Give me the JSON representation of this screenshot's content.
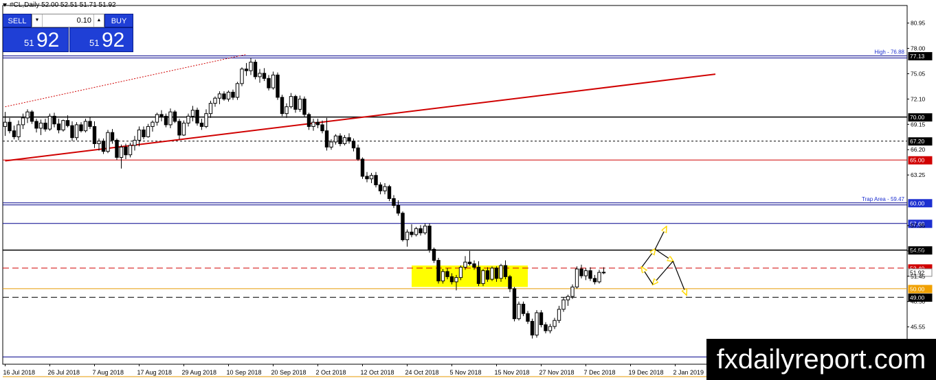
{
  "header": {
    "symbol_line": "#CL,Daily  52.00 52.51 51.71 51.92"
  },
  "trade_panel": {
    "sell_label": "SELL",
    "buy_label": "BUY",
    "lot_value": "0.10",
    "sell_price_small": "51",
    "sell_price_big": "92",
    "buy_price_small": "51",
    "buy_price_big": "92"
  },
  "watermark": "fxdailyreport.com",
  "chart_data": {
    "type": "candlestick",
    "title": "#CL,Daily",
    "ylim": [
      41.2,
      83.0
    ],
    "y_ticks": [
      "80.95",
      "78.00",
      "75.05",
      "72.10",
      "69.15",
      "66.20",
      "63.25",
      "57.35",
      "54.40",
      "51.45",
      "48.50",
      "45.55",
      "42.60"
    ],
    "x_labels": [
      "16 Jul 2018",
      "26 Jul 2018",
      "7 Aug 2018",
      "17 Aug 2018",
      "29 Aug 2018",
      "10 Sep 2018",
      "20 Sep 2018",
      "2 Oct 2018",
      "12 Oct 2018",
      "24 Oct 2018",
      "5 Nov 2018",
      "15 Nov 2018",
      "27 Nov 2018",
      "7 Dec 2018",
      "19 Dec 2018",
      "2 Jan 2019"
    ],
    "levels": [
      {
        "value": 77.13,
        "label": "77.13",
        "color": "#00008b",
        "style": "solid",
        "tag_color": "#000000",
        "note": "High - 76.88"
      },
      {
        "value": 70.0,
        "label": "70.00",
        "color": "#000000",
        "style": "solid",
        "tag_color": "#000000"
      },
      {
        "value": 67.2,
        "label": "67.20",
        "color": "#000000",
        "style": "dotted",
        "tag_color": "#000000"
      },
      {
        "value": 65.0,
        "label": "65.00",
        "color": "#d00000",
        "style": "solid",
        "tag_color": "#d00000"
      },
      {
        "value": 60.0,
        "label": "60.00",
        "color": "#00008b",
        "style": "solid",
        "tag_color": "#1c2fd0",
        "note": "Trap Area - 59.47"
      },
      {
        "value": 57.6,
        "label": "57.60",
        "color": "#00008b",
        "style": "solid",
        "tag_color": "#1c2fd0"
      },
      {
        "value": 54.5,
        "label": "54.50",
        "color": "#000000",
        "style": "solid",
        "tag_color": "#000000"
      },
      {
        "value": 52.4,
        "label": "52.40",
        "color": "#d00000",
        "style": "dashed",
        "tag_color": "#d00000"
      },
      {
        "value": 51.92,
        "label": "51.92",
        "color": "#9a9a9a",
        "style": "none",
        "tag_color": "#ffffff"
      },
      {
        "value": 50.0,
        "label": "50.00",
        "color": "#e69a00",
        "style": "solid",
        "tag_color": "#f0a000"
      },
      {
        "value": 49.0,
        "label": "49.00",
        "color": "#000000",
        "style": "dashed",
        "tag_color": "#000000"
      },
      {
        "value": 42.05,
        "label": "",
        "color": "#00008b",
        "style": "solid",
        "tag_color": "",
        "note": "Low - 42.05"
      },
      {
        "value": 39.75,
        "label": "",
        "color": "#e69a00",
        "style": "solid",
        "tag_color": "#e69a00"
      }
    ],
    "trendlines": [
      {
        "name": "red-trendline",
        "color": "#d00000",
        "from": [
          0,
          64.9
        ],
        "to": [
          159,
          75.0
        ],
        "style": "solid"
      },
      {
        "name": "red-dotted-trendline",
        "color": "#d00000",
        "from": [
          0,
          71.2
        ],
        "to": [
          54,
          77.3
        ],
        "style": "dotted"
      }
    ],
    "zone": {
      "color": "#ffff00",
      "from_x": 91,
      "to_x": 117,
      "y_low": 50.2,
      "y_high": 52.7
    },
    "candles": [
      [
        68.9,
        70.6,
        67.8,
        69.4
      ],
      [
        69.4,
        69.9,
        68.1,
        68.4
      ],
      [
        68.4,
        69.0,
        67.4,
        67.7
      ],
      [
        67.7,
        69.6,
        67.3,
        69.1
      ],
      [
        69.1,
        70.4,
        68.6,
        69.9
      ],
      [
        69.9,
        70.9,
        69.3,
        70.6
      ],
      [
        70.6,
        70.8,
        69.2,
        69.5
      ],
      [
        69.5,
        69.8,
        68.2,
        68.7
      ],
      [
        68.7,
        69.7,
        67.9,
        69.3
      ],
      [
        69.3,
        69.8,
        68.3,
        68.6
      ],
      [
        68.6,
        70.4,
        68.4,
        70.1
      ],
      [
        70.1,
        70.5,
        68.8,
        69.2
      ],
      [
        69.2,
        69.8,
        68.1,
        68.5
      ],
      [
        68.5,
        69.7,
        68.3,
        69.6
      ],
      [
        69.6,
        70.2,
        68.8,
        69.0
      ],
      [
        69.0,
        69.5,
        67.2,
        67.6
      ],
      [
        67.6,
        69.4,
        67.3,
        69.1
      ],
      [
        69.1,
        69.4,
        68.2,
        68.4
      ],
      [
        68.4,
        69.8,
        68.2,
        69.5
      ],
      [
        69.5,
        70.0,
        68.6,
        68.9
      ],
      [
        68.9,
        69.5,
        66.4,
        66.9
      ],
      [
        66.9,
        67.5,
        66.1,
        67.2
      ],
      [
        67.2,
        67.5,
        65.7,
        66.0
      ],
      [
        66.0,
        68.5,
        65.8,
        68.2
      ],
      [
        68.2,
        68.6,
        66.9,
        67.3
      ],
      [
        67.3,
        67.5,
        65.0,
        65.3
      ],
      [
        65.3,
        66.8,
        64.0,
        66.5
      ],
      [
        66.5,
        66.9,
        65.1,
        65.6
      ],
      [
        65.6,
        67.0,
        65.3,
        66.7
      ],
      [
        66.7,
        67.8,
        66.1,
        67.3
      ],
      [
        67.3,
        68.9,
        66.6,
        68.5
      ],
      [
        68.5,
        68.9,
        67.4,
        67.7
      ],
      [
        67.7,
        69.2,
        67.6,
        68.9
      ],
      [
        68.9,
        69.6,
        68.3,
        69.4
      ],
      [
        69.4,
        70.5,
        69.0,
        70.3
      ],
      [
        70.3,
        70.8,
        69.5,
        70.1
      ],
      [
        70.1,
        70.4,
        68.8,
        69.1
      ],
      [
        69.1,
        71.0,
        68.7,
        70.6
      ],
      [
        70.6,
        70.8,
        69.3,
        69.5
      ],
      [
        69.5,
        69.8,
        67.4,
        67.9
      ],
      [
        67.9,
        69.6,
        67.8,
        69.3
      ],
      [
        69.3,
        70.4,
        68.9,
        70.1
      ],
      [
        70.1,
        71.3,
        69.5,
        70.8
      ],
      [
        70.8,
        71.1,
        69.0,
        69.3
      ],
      [
        69.3,
        69.8,
        68.5,
        68.9
      ],
      [
        68.9,
        70.9,
        68.7,
        70.4
      ],
      [
        70.4,
        71.9,
        69.9,
        71.6
      ],
      [
        71.6,
        72.4,
        71.2,
        72.2
      ],
      [
        72.2,
        73.0,
        71.5,
        72.7
      ],
      [
        72.7,
        73.0,
        71.9,
        72.1
      ],
      [
        72.1,
        73.1,
        71.8,
        72.9
      ],
      [
        72.9,
        73.2,
        72.0,
        72.3
      ],
      [
        72.3,
        74.1,
        72.0,
        73.9
      ],
      [
        73.9,
        75.8,
        73.6,
        75.6
      ],
      [
        75.6,
        76.3,
        74.8,
        75.4
      ],
      [
        75.4,
        76.9,
        74.9,
        76.4
      ],
      [
        76.4,
        76.7,
        74.4,
        74.7
      ],
      [
        74.7,
        75.6,
        74.0,
        75.1
      ],
      [
        75.1,
        75.7,
        74.2,
        74.5
      ],
      [
        74.5,
        74.9,
        73.1,
        73.4
      ],
      [
        73.4,
        75.3,
        73.2,
        74.9
      ],
      [
        74.9,
        75.2,
        72.0,
        72.3
      ],
      [
        72.3,
        72.6,
        70.1,
        70.4
      ],
      [
        70.4,
        71.6,
        69.9,
        71.2
      ],
      [
        71.2,
        72.8,
        71.0,
        72.4
      ],
      [
        72.4,
        72.6,
        70.5,
        70.9
      ],
      [
        70.9,
        72.5,
        70.6,
        72.1
      ],
      [
        72.1,
        72.4,
        70.0,
        70.3
      ],
      [
        70.3,
        70.5,
        68.5,
        68.9
      ],
      [
        68.9,
        69.8,
        68.4,
        69.4
      ],
      [
        69.4,
        69.8,
        68.7,
        69.1
      ],
      [
        69.1,
        69.6,
        68.1,
        68.4
      ],
      [
        68.4,
        69.9,
        66.1,
        66.5
      ],
      [
        66.5,
        67.4,
        66.2,
        67.1
      ],
      [
        67.1,
        68.0,
        66.8,
        67.8
      ],
      [
        67.8,
        68.1,
        66.6,
        66.9
      ],
      [
        66.9,
        67.9,
        66.7,
        67.6
      ],
      [
        67.6,
        68.1,
        66.9,
        67.2
      ],
      [
        67.2,
        67.5,
        66.0,
        66.4
      ],
      [
        66.4,
        66.8,
        64.9,
        65.1
      ],
      [
        65.1,
        65.3,
        62.8,
        63.1
      ],
      [
        63.1,
        63.6,
        62.4,
        62.8
      ],
      [
        62.8,
        63.5,
        62.3,
        63.2
      ],
      [
        63.2,
        63.6,
        61.8,
        62.1
      ],
      [
        62.1,
        62.4,
        61.0,
        61.4
      ],
      [
        61.4,
        62.3,
        61.0,
        61.9
      ],
      [
        61.9,
        62.1,
        60.2,
        60.5
      ],
      [
        60.5,
        60.9,
        59.4,
        59.7
      ],
      [
        59.7,
        60.3,
        58.5,
        58.8
      ],
      [
        58.8,
        59.0,
        55.5,
        55.7
      ],
      [
        55.7,
        56.9,
        54.9,
        56.6
      ],
      [
        56.6,
        57.5,
        56.0,
        56.3
      ],
      [
        56.3,
        57.2,
        56.1,
        57.0
      ],
      [
        57.0,
        57.4,
        56.2,
        56.5
      ],
      [
        56.5,
        57.6,
        56.3,
        57.3
      ],
      [
        57.3,
        57.6,
        54.2,
        54.6
      ],
      [
        54.6,
        54.8,
        53.0,
        53.3
      ],
      [
        53.3,
        53.6,
        50.6,
        50.9
      ],
      [
        50.9,
        52.3,
        50.6,
        52.0
      ],
      [
        52.0,
        52.4,
        51.1,
        51.4
      ],
      [
        51.4,
        51.8,
        50.5,
        50.8
      ],
      [
        50.8,
        51.6,
        49.8,
        51.3
      ],
      [
        51.3,
        52.7,
        51.0,
        52.5
      ],
      [
        52.5,
        53.8,
        52.2,
        53.1
      ],
      [
        53.1,
        54.4,
        52.7,
        52.9
      ],
      [
        52.9,
        53.3,
        52.2,
        52.5
      ],
      [
        52.5,
        53.2,
        50.3,
        50.6
      ],
      [
        50.6,
        52.3,
        50.3,
        52.1
      ],
      [
        52.1,
        52.5,
        50.8,
        51.1
      ],
      [
        51.1,
        52.6,
        50.9,
        52.4
      ],
      [
        52.4,
        52.6,
        50.8,
        51.2
      ],
      [
        51.2,
        52.9,
        50.8,
        52.7
      ],
      [
        52.7,
        53.3,
        51.1,
        51.4
      ],
      [
        51.4,
        51.6,
        49.6,
        50.0
      ],
      [
        50.0,
        50.2,
        46.2,
        46.5
      ],
      [
        46.5,
        48.5,
        46.3,
        48.2
      ],
      [
        48.2,
        48.5,
        46.8,
        47.1
      ],
      [
        47.1,
        47.4,
        45.9,
        46.2
      ],
      [
        46.2,
        46.5,
        44.2,
        44.6
      ],
      [
        44.6,
        47.5,
        44.3,
        47.2
      ],
      [
        47.2,
        47.5,
        45.5,
        45.8
      ],
      [
        45.8,
        46.1,
        44.8,
        45.1
      ],
      [
        45.1,
        45.9,
        44.8,
        45.6
      ],
      [
        45.6,
        46.6,
        45.3,
        46.3
      ],
      [
        46.3,
        48.0,
        46.0,
        47.6
      ],
      [
        47.6,
        49.0,
        47.3,
        48.7
      ],
      [
        48.7,
        49.3,
        48.0,
        49.1
      ],
      [
        49.1,
        50.5,
        48.8,
        50.2
      ],
      [
        50.2,
        52.6,
        50.0,
        52.3
      ],
      [
        52.3,
        52.8,
        51.2,
        51.5
      ],
      [
        51.5,
        52.4,
        51.0,
        52.1
      ],
      [
        52.1,
        52.5,
        50.9,
        51.2
      ],
      [
        51.2,
        51.6,
        50.5,
        50.8
      ],
      [
        50.8,
        52.2,
        50.6,
        51.9
      ],
      [
        51.9,
        52.5,
        51.7,
        51.92
      ]
    ],
    "arrows_color": "#ffd800",
    "projection_arrows": [
      [
        [
          142.5,
          52.5
        ],
        [
          145.5,
          54.6
        ]
      ],
      [
        [
          145.5,
          54.6
        ],
        [
          148.0,
          57.2
        ]
      ],
      [
        [
          145.5,
          54.6
        ],
        [
          149.5,
          53.2
        ]
      ],
      [
        [
          149.5,
          53.2
        ],
        [
          145.0,
          50.5
        ]
      ],
      [
        [
          145.0,
          50.5
        ],
        [
          142.5,
          52.5
        ]
      ],
      [
        [
          149.5,
          53.2
        ],
        [
          152.5,
          49.3
        ]
      ]
    ]
  }
}
